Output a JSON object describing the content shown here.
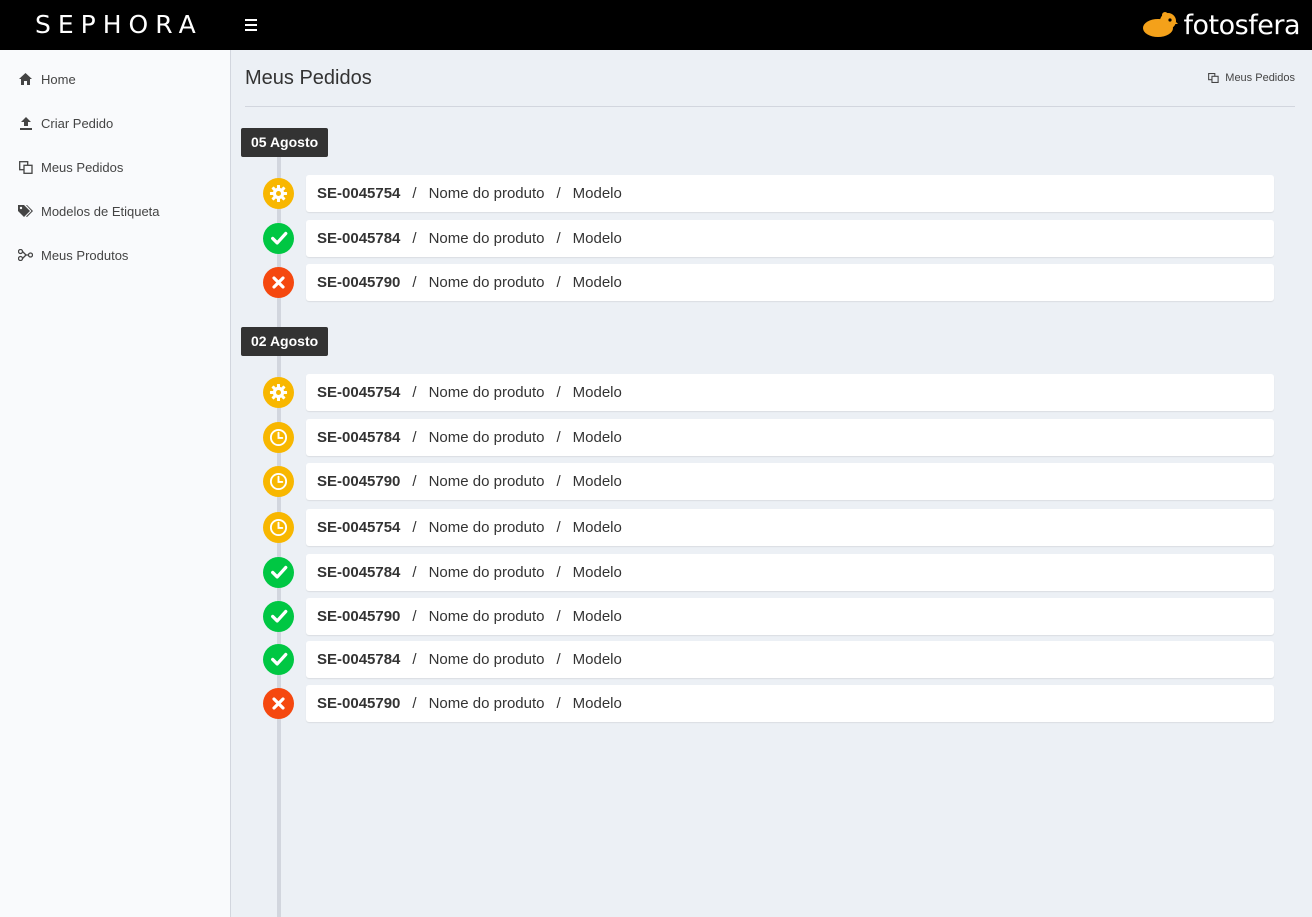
{
  "header": {
    "brand": "SEPHORA",
    "logo_text": "fotosfera",
    "logo_color": "#f4a11a"
  },
  "sidebar": {
    "items": [
      {
        "label": "Home",
        "icon": "home-icon"
      },
      {
        "label": "Criar Pedido",
        "icon": "upload-icon"
      },
      {
        "label": "Meus Pedidos",
        "icon": "copy-icon"
      },
      {
        "label": "Modelos de Etiqueta",
        "icon": "tags-icon"
      },
      {
        "label": "Meus Produtos",
        "icon": "code-fork-icon"
      }
    ]
  },
  "page": {
    "title": "Meus Pedidos",
    "breadcrumb": "Meus Pedidos"
  },
  "status_colors": {
    "processing": "#f8b700",
    "pending": "#f8b700",
    "done": "#00c743",
    "cancelled": "#f5480f"
  },
  "groups": [
    {
      "date": "05 Agosto",
      "orders": [
        {
          "code": "SE-0045754",
          "product": "Nome do produto",
          "model": "Modelo",
          "status": "processing"
        },
        {
          "code": "SE-0045784",
          "product": "Nome do produto",
          "model": "Modelo",
          "status": "done"
        },
        {
          "code": "SE-0045790",
          "product": "Nome do produto",
          "model": "Modelo",
          "status": "cancelled"
        }
      ]
    },
    {
      "date": "02 Agosto",
      "orders": [
        {
          "code": "SE-0045754",
          "product": "Nome do produto",
          "model": "Modelo",
          "status": "processing"
        },
        {
          "code": "SE-0045784",
          "product": "Nome do produto",
          "model": "Modelo",
          "status": "pending"
        },
        {
          "code": "SE-0045790",
          "product": "Nome do produto",
          "model": "Modelo",
          "status": "pending"
        },
        {
          "code": "SE-0045754",
          "product": "Nome do produto",
          "model": "Modelo",
          "status": "pending"
        },
        {
          "code": "SE-0045784",
          "product": "Nome do produto",
          "model": "Modelo",
          "status": "done"
        },
        {
          "code": "SE-0045790",
          "product": "Nome do produto",
          "model": "Modelo",
          "status": "done"
        },
        {
          "code": "SE-0045784",
          "product": "Nome do produto",
          "model": "Modelo",
          "status": "done"
        },
        {
          "code": "SE-0045790",
          "product": "Nome do produto",
          "model": "Modelo",
          "status": "cancelled"
        }
      ]
    }
  ]
}
